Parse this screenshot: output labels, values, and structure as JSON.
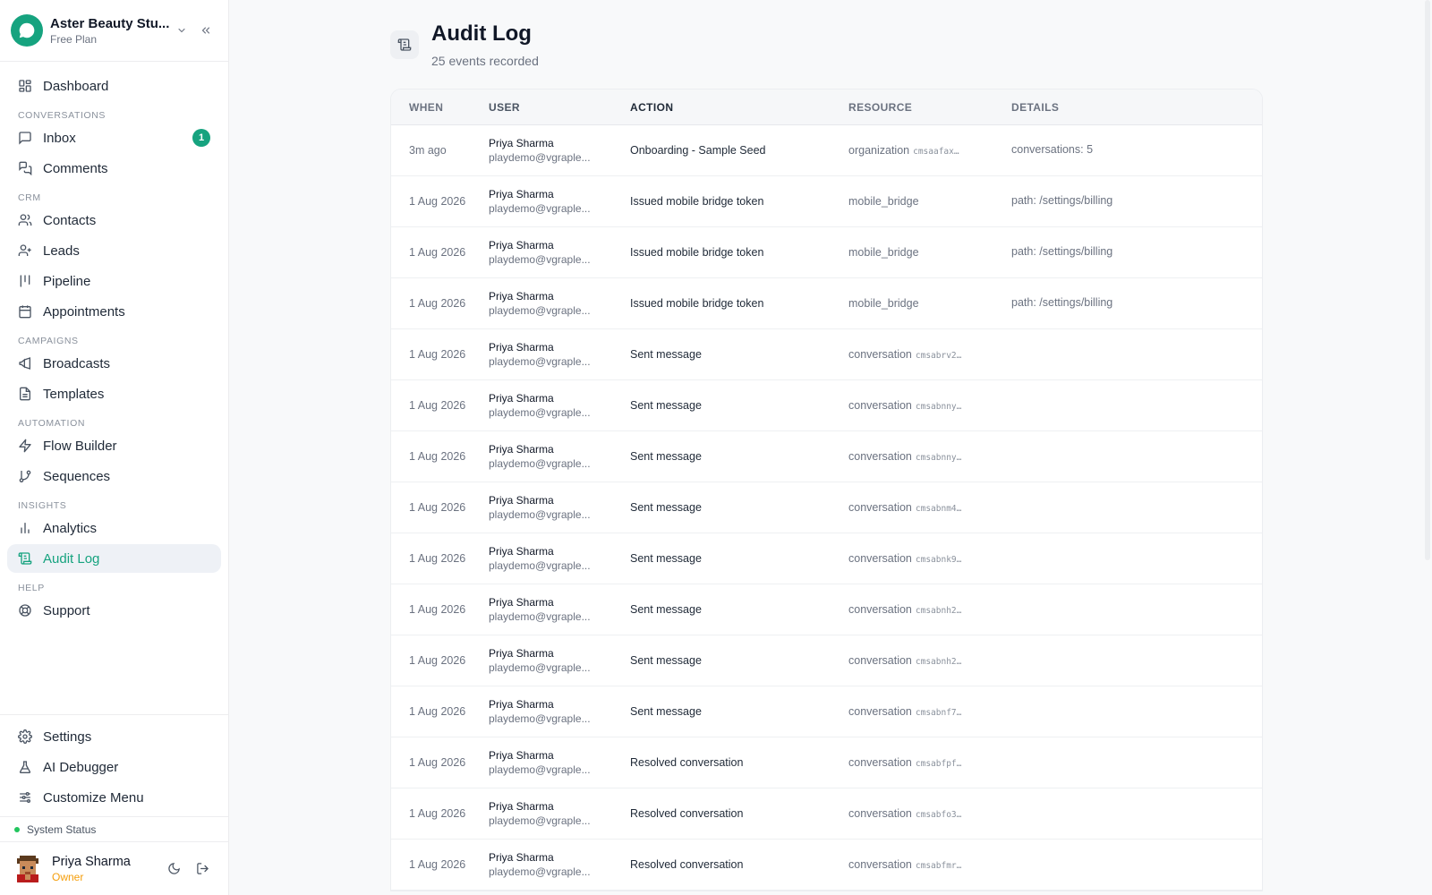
{
  "workspace": {
    "name": "Aster Beauty Stu...",
    "plan": "Free Plan"
  },
  "nav": {
    "dashboard": "Dashboard",
    "sec_conversations": "CONVERSATIONS",
    "inbox": "Inbox",
    "inbox_badge": "1",
    "comments": "Comments",
    "sec_crm": "CRM",
    "contacts": "Contacts",
    "leads": "Leads",
    "pipeline": "Pipeline",
    "appointments": "Appointments",
    "sec_campaigns": "CAMPAIGNS",
    "broadcasts": "Broadcasts",
    "templates": "Templates",
    "sec_automation": "AUTOMATION",
    "flow_builder": "Flow Builder",
    "sequences": "Sequences",
    "sec_insights": "INSIGHTS",
    "analytics": "Analytics",
    "audit_log": "Audit Log",
    "sec_help": "HELP",
    "support": "Support"
  },
  "bottom_nav": {
    "settings": "Settings",
    "ai_debugger": "AI Debugger",
    "customize_menu": "Customize Menu"
  },
  "status": {
    "label": "System Status"
  },
  "user": {
    "name": "Priya Sharma",
    "role": "Owner"
  },
  "page": {
    "title": "Audit Log",
    "subtitle": "25 events recorded"
  },
  "table": {
    "headers": [
      "WHEN",
      "USER",
      "ACTION",
      "RESOURCE",
      "DETAILS"
    ],
    "rows": [
      {
        "when": "3m ago",
        "user": "Priya Sharma",
        "email": "playdemo@vgraple...",
        "action": "Onboarding - Sample Seed",
        "resource": "organization",
        "resource_id": "cmsaafax…",
        "details": "conversations: 5"
      },
      {
        "when": "1 Aug 2026",
        "user": "Priya Sharma",
        "email": "playdemo@vgraple...",
        "action": "Issued mobile bridge token",
        "resource": "mobile_bridge",
        "resource_id": "",
        "details": "path: /settings/billing"
      },
      {
        "when": "1 Aug 2026",
        "user": "Priya Sharma",
        "email": "playdemo@vgraple...",
        "action": "Issued mobile bridge token",
        "resource": "mobile_bridge",
        "resource_id": "",
        "details": "path: /settings/billing"
      },
      {
        "when": "1 Aug 2026",
        "user": "Priya Sharma",
        "email": "playdemo@vgraple...",
        "action": "Issued mobile bridge token",
        "resource": "mobile_bridge",
        "resource_id": "",
        "details": "path: /settings/billing"
      },
      {
        "when": "1 Aug 2026",
        "user": "Priya Sharma",
        "email": "playdemo@vgraple...",
        "action": "Sent message",
        "resource": "conversation",
        "resource_id": "cmsabrv2…",
        "details": ""
      },
      {
        "when": "1 Aug 2026",
        "user": "Priya Sharma",
        "email": "playdemo@vgraple...",
        "action": "Sent message",
        "resource": "conversation",
        "resource_id": "cmsabnny…",
        "details": ""
      },
      {
        "when": "1 Aug 2026",
        "user": "Priya Sharma",
        "email": "playdemo@vgraple...",
        "action": "Sent message",
        "resource": "conversation",
        "resource_id": "cmsabnny…",
        "details": ""
      },
      {
        "when": "1 Aug 2026",
        "user": "Priya Sharma",
        "email": "playdemo@vgraple...",
        "action": "Sent message",
        "resource": "conversation",
        "resource_id": "cmsabnm4…",
        "details": ""
      },
      {
        "when": "1 Aug 2026",
        "user": "Priya Sharma",
        "email": "playdemo@vgraple...",
        "action": "Sent message",
        "resource": "conversation",
        "resource_id": "cmsabnk9…",
        "details": ""
      },
      {
        "when": "1 Aug 2026",
        "user": "Priya Sharma",
        "email": "playdemo@vgraple...",
        "action": "Sent message",
        "resource": "conversation",
        "resource_id": "cmsabnh2…",
        "details": ""
      },
      {
        "when": "1 Aug 2026",
        "user": "Priya Sharma",
        "email": "playdemo@vgraple...",
        "action": "Sent message",
        "resource": "conversation",
        "resource_id": "cmsabnh2…",
        "details": ""
      },
      {
        "when": "1 Aug 2026",
        "user": "Priya Sharma",
        "email": "playdemo@vgraple...",
        "action": "Sent message",
        "resource": "conversation",
        "resource_id": "cmsabnf7…",
        "details": ""
      },
      {
        "when": "1 Aug 2026",
        "user": "Priya Sharma",
        "email": "playdemo@vgraple...",
        "action": "Resolved conversation",
        "resource": "conversation",
        "resource_id": "cmsabfpf…",
        "details": ""
      },
      {
        "when": "1 Aug 2026",
        "user": "Priya Sharma",
        "email": "playdemo@vgraple...",
        "action": "Resolved conversation",
        "resource": "conversation",
        "resource_id": "cmsabfo3…",
        "details": ""
      },
      {
        "when": "1 Aug 2026",
        "user": "Priya Sharma",
        "email": "playdemo@vgraple...",
        "action": "Resolved conversation",
        "resource": "conversation",
        "resource_id": "cmsabfmr…",
        "details": ""
      }
    ]
  },
  "colors": {
    "accent": "#16a37f",
    "active_bg": "#eef1f6",
    "status_ok": "#22c55e",
    "role": "#f59e0b"
  },
  "icons": [
    "chat-bubble-icon",
    "chevron-down-icon",
    "chevrons-left-icon",
    "grid-icon",
    "message-square-icon",
    "messages-icon",
    "users-icon",
    "user-plus-icon",
    "kanban-icon",
    "calendar-icon",
    "megaphone-icon",
    "file-text-icon",
    "zap-icon",
    "git-branch-icon",
    "bar-chart-icon",
    "scroll-icon",
    "life-buoy-icon",
    "gear-icon",
    "flask-icon",
    "sliders-icon",
    "moon-icon",
    "log-out-icon"
  ]
}
